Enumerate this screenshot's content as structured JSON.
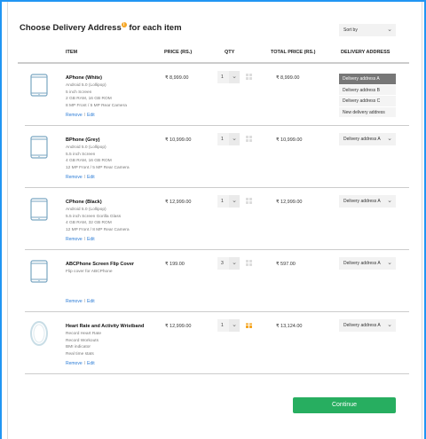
{
  "title": "Choose Delivery Address",
  "title_suffix": "for each item",
  "info_icon": "i",
  "sort": {
    "label": "Sort by"
  },
  "headers": {
    "item": "ITEM",
    "price": "PRICE (RS.)",
    "qty": "QTY",
    "total": "TOTAL PRICE (RS.)",
    "delivery": "DELIVERY ADDRESS"
  },
  "links": {
    "remove": "Remove",
    "sep": "I",
    "edit": "Edit"
  },
  "items": [
    {
      "name": "APhone (White)",
      "desc": [
        "Android 5.0 (Lollipop)",
        "5 inch Screen",
        "2 GB RAM, 16 GB ROM",
        "8 MP Front / 5 MP Rear Camera"
      ],
      "price": "₹ 8,999.00",
      "qty": "1",
      "total": "₹ 8,999.00",
      "delivery": "Delivery address A",
      "gift": false,
      "type": "phone"
    },
    {
      "name": "BPhone (Grey)",
      "desc": [
        "Android 5.0 (Lollipop)",
        "5.5 inch Screen",
        "4 GB RAM, 16 GB ROM",
        "12 MP Front / 5 MP Rear Camera"
      ],
      "price": "₹ 10,999.00",
      "qty": "1",
      "total": "₹ 10,999.00",
      "delivery": "Delivery address A",
      "gift": false,
      "type": "phone"
    },
    {
      "name": "CPhone (Black)",
      "desc": [
        "Android 5.0 (Lollipop)",
        "5.5 inch Screen Gorilla Glass",
        "4 GB RAM, 32 GB ROM",
        "12 MP Front / 8 MP Rear Camera"
      ],
      "price": "₹ 12,999.00",
      "qty": "1",
      "total": "₹ 12,999.00",
      "delivery": "Delivery address A",
      "gift": false,
      "type": "phone"
    },
    {
      "name": "ABCPhone Screen Flip  Cover",
      "desc": [
        "Flip cover for ABCPhone"
      ],
      "price": "₹ 199.00",
      "qty": "3",
      "total": "₹ 597.00",
      "delivery": "Delivery address A",
      "gift": false,
      "type": "phone"
    },
    {
      "name": "Heart Rate and Activity Wristband",
      "desc": [
        "Record Heart Rate",
        "Record Workouts",
        "BMI indicator",
        "Real time stats"
      ],
      "price": "₹ 12,999.00",
      "qty": "1",
      "total": "₹ 13,124.00",
      "delivery": "Delivery address A",
      "gift": true,
      "type": "band"
    }
  ],
  "delivery_options": [
    "Delivery address A",
    "Delivery address B",
    "Delivery address C",
    "New delivery address"
  ],
  "continue_label": "Continue",
  "colors": {
    "accent": "#27ae60",
    "link": "#2a7bd6",
    "gift": "#f5a623",
    "frame": "#2196f3"
  }
}
